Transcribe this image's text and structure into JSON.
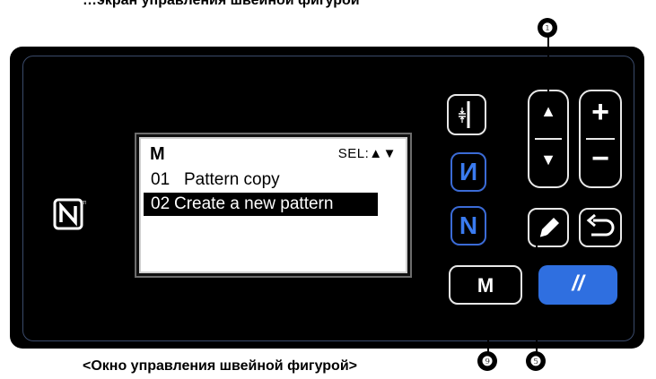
{
  "top_caption": "…экран управления швейной фигурой",
  "bottom_caption": "<Окно управления швейной фигурой>",
  "lcd": {
    "title": "M",
    "sel_label": "SEL:▲▼",
    "items": [
      {
        "num": "01",
        "label": "Pattern copy",
        "selected": false
      },
      {
        "num": "02",
        "label": "Create a new pattern",
        "selected": true
      }
    ]
  },
  "buttons": {
    "threading_icon": "thread-tension-icon",
    "up_arrow": "▲",
    "down_arrow": "▼",
    "plus": "+",
    "minus": "−",
    "counter_icon": "И",
    "n_label": "N",
    "edit_icon": "pencil-icon",
    "return_icon": "return-arrow-icon",
    "m_label": "M",
    "reset_icon": "//"
  },
  "callouts": [
    "❶",
    "❺",
    "❾"
  ],
  "colors": {
    "panel": "#000000",
    "accent_blue": "#2f6fe0",
    "lcd_bg": "#ffffff"
  }
}
